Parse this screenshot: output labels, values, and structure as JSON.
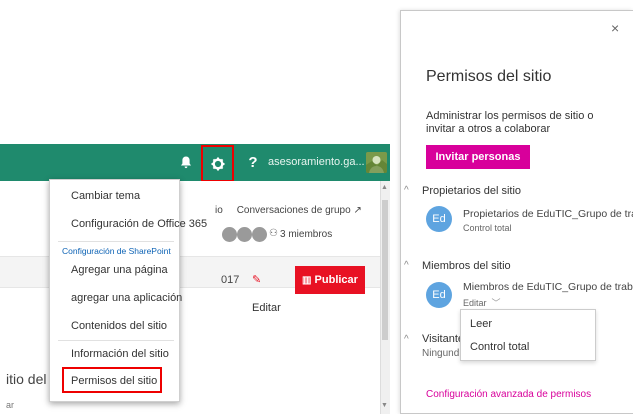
{
  "sharepoint": {
    "user_name": "asesoramiento.ga...",
    "help": "?",
    "nav_link": "Conversaciones de grupo ↗",
    "nav_prefix": "io",
    "members_label": "3 miembros",
    "date_fragment": "017",
    "edit_label": "Editar",
    "publish_label": "Publicar",
    "site_title_fragment": "itio del",
    "site_sub_fragment": "ar"
  },
  "menu": {
    "items": [
      "Cambiar tema",
      "Configuración de Office 365",
      "Configuración de SharePoint",
      "Agregar una página",
      "agregar una aplicación",
      "Contenidos del sitio",
      "Información del sitio",
      "Permisos del sitio"
    ]
  },
  "panel": {
    "close": "×",
    "title": "Permisos del sitio",
    "description": "Administrar los permisos de sitio o invitar a otros a colaborar",
    "invite_label": "Invitar personas",
    "owners_section": "Propietarios del sitio",
    "owners_group": "Propietarios de EduTIC_Grupo de trab",
    "owners_role": "Control total",
    "members_section": "Miembros del sitio",
    "members_group": "Miembros de EduTIC_Grupo de trabaj",
    "members_role": "Editar",
    "visitors_section": "Visitante",
    "visitors_role": "Ningund",
    "avatar_initials": "Ed",
    "advanced_link": "Configuración avanzada de permisos",
    "role_options": [
      "Leer",
      "Control total"
    ]
  },
  "colors": {
    "suite_bar": "#1f8a6d",
    "publish": "#e81123",
    "accent": "#d8009b",
    "highlight": "#ee0000",
    "avatar": "#5ea4e0"
  }
}
